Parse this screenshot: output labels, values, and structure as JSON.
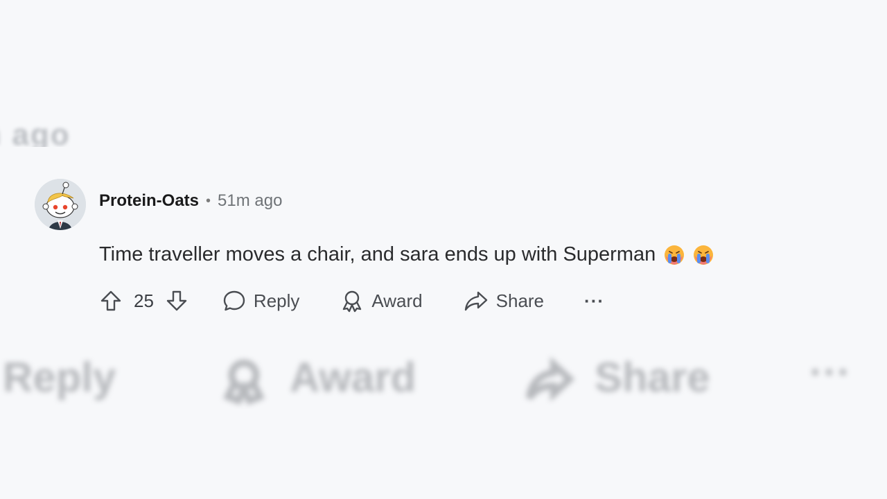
{
  "blurred": {
    "top_text": "m ago",
    "bottom": {
      "reply_label": "Reply",
      "award_label": "Award",
      "share_label": "Share",
      "more_label": "···"
    }
  },
  "comment": {
    "author": "Protein-Oats",
    "separator": "•",
    "time_ago": "51m ago",
    "text": "Time traveller moves a chair, and sara ends up with Superman",
    "emojis": [
      "crying-face",
      "crying-face"
    ],
    "vote_count": "25",
    "actions": {
      "reply_label": "Reply",
      "award_label": "Award",
      "share_label": "Share",
      "more_label": "···"
    }
  },
  "colors": {
    "background": "#f7f8fa",
    "text": "#1c1c1c",
    "meta": "#6f7377",
    "action": "#4a4d52"
  }
}
